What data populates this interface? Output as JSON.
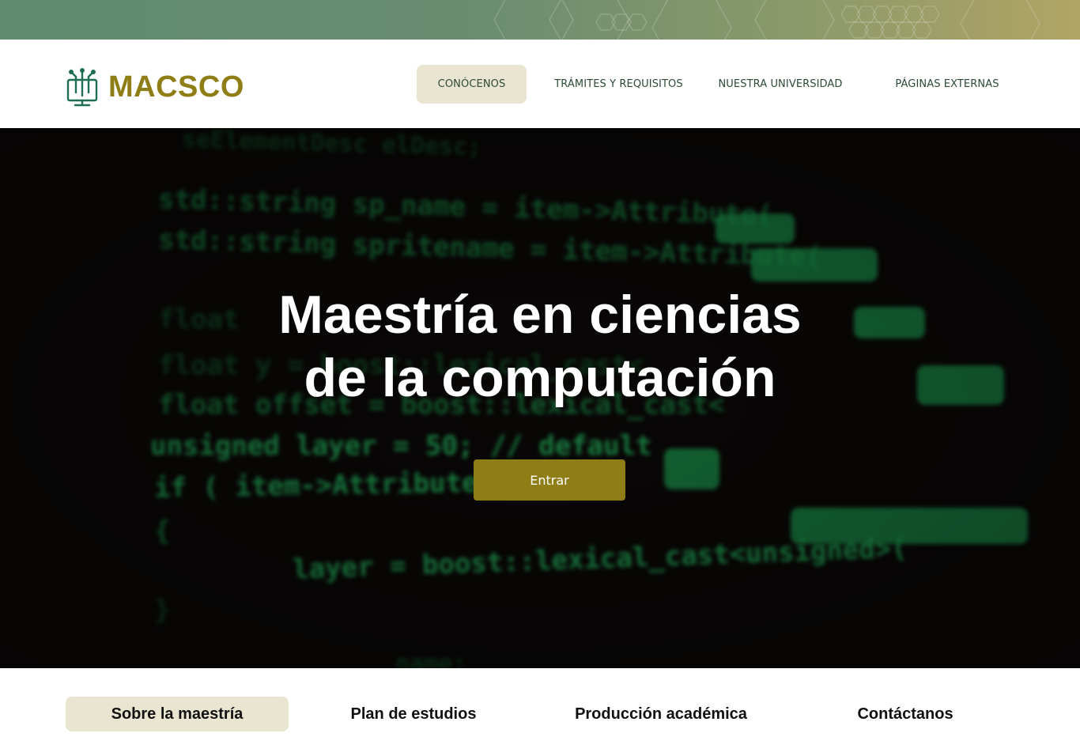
{
  "brand": {
    "name": "MACSCO",
    "color": "#8f7d15",
    "logo_icon": "circuit-monitor-icon"
  },
  "nav": {
    "items": [
      {
        "label": "CONÓCENOS",
        "active": true
      },
      {
        "label": "TRÁMITES Y REQUISITOS",
        "active": false
      },
      {
        "label": "NUESTRA UNIVERSIDAD",
        "active": false
      },
      {
        "label": "PÁGINAS EXTERNAS",
        "active": false
      }
    ]
  },
  "hero": {
    "title_line1": "Maestría en ciencias",
    "title_line2": "de la computación",
    "button_label": "Entrar",
    "background": "blurred-green-source-code-image"
  },
  "tabs": {
    "items": [
      {
        "label": "Sobre la maestría",
        "active": true
      },
      {
        "label": "Plan de estudios",
        "active": false
      },
      {
        "label": "Producción académica",
        "active": false
      },
      {
        "label": "Contáctanos",
        "active": false
      }
    ]
  },
  "colors": {
    "accent_gold": "#8f7d15",
    "active_tab_bg": "#eae5d1",
    "nav_text": "#2c4a36",
    "strip_green": "#5f8a6e",
    "strip_gold": "#b2a465"
  }
}
